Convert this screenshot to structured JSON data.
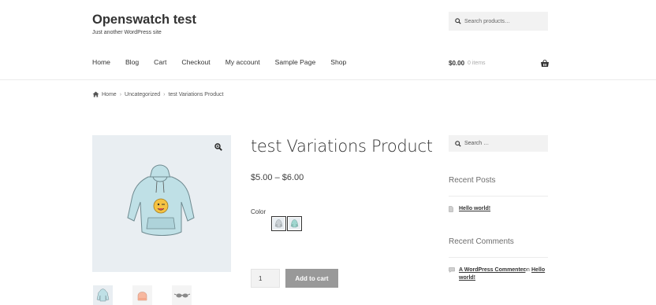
{
  "site": {
    "title": "Openswatch test",
    "tagline": "Just another WordPress site"
  },
  "header_search": {
    "placeholder": "Search products…"
  },
  "nav": {
    "items": [
      "Home",
      "Blog",
      "Cart",
      "Checkout",
      "My account",
      "Sample Page",
      "Shop"
    ]
  },
  "cart": {
    "amount": "$0.00",
    "items": "0 items",
    "icon": "basket-icon"
  },
  "breadcrumb": {
    "home_icon": "home-icon",
    "items": [
      "Home",
      "Uncategorized",
      "test Variations Product"
    ],
    "separator": "›"
  },
  "product": {
    "title": "test Variations Product",
    "price": "$5.00 – $6.00",
    "color_label": "Color",
    "swatches": [
      "grey-hoodie-swatch",
      "teal-hoodie-swatch"
    ],
    "quantity": "1",
    "add_to_cart": "Add to cart",
    "zoom_icon": "zoom-icon",
    "image": "hoodie-image",
    "thumbnails": [
      "hoodie-thumbnail",
      "beanie-thumbnail",
      "sunglasses-thumbnail"
    ]
  },
  "sidebar": {
    "search_placeholder": "Search …",
    "recent_posts_title": "Recent Posts",
    "recent_posts": [
      "Hello world!"
    ],
    "recent_comments_title": "Recent Comments",
    "comment": {
      "author": "A WordPress Commenter",
      "on": "on",
      "post_line1": "Hello",
      "post_line2": "world!"
    }
  },
  "colors": {
    "image_bg": "#e9eef2",
    "button_bg": "#999999",
    "input_bg": "#f2f2f2",
    "hoodie": "#bfe0e6"
  }
}
